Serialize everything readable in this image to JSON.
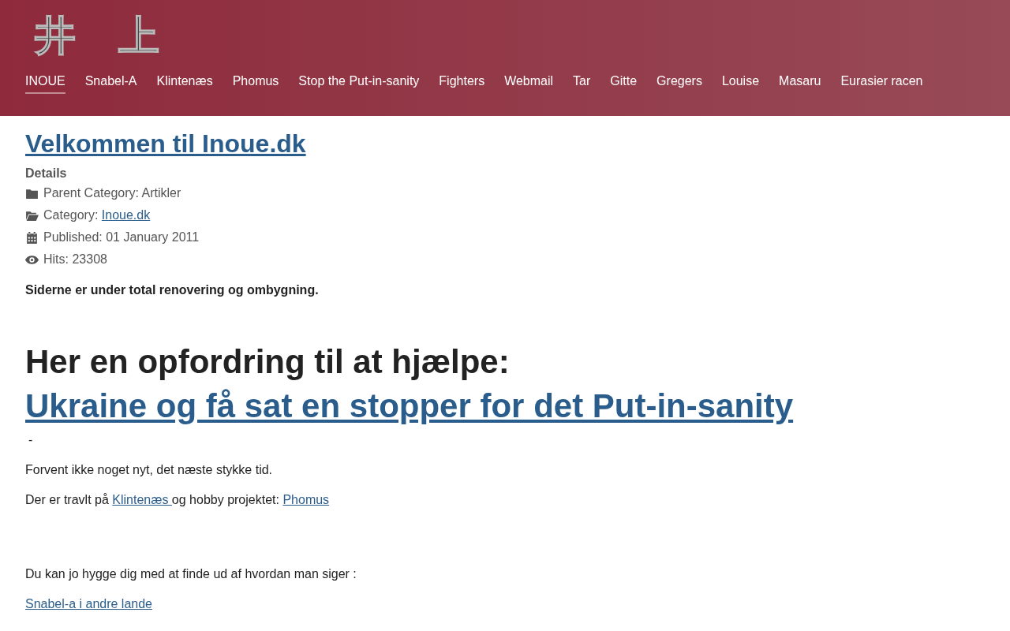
{
  "logo": {
    "text": "井 上"
  },
  "nav": [
    {
      "label": "INOUE",
      "selected": true
    },
    {
      "label": "Snabel-A",
      "selected": false
    },
    {
      "label": "Klintenæs",
      "selected": false
    },
    {
      "label": "Phomus",
      "selected": false
    },
    {
      "label": "Stop the Put-in-sanity",
      "selected": false
    },
    {
      "label": "Fighters",
      "selected": false
    },
    {
      "label": "Webmail",
      "selected": false
    },
    {
      "label": "Tar",
      "selected": false
    },
    {
      "label": "Gitte",
      "selected": false
    },
    {
      "label": "Gregers",
      "selected": false
    },
    {
      "label": "Louise",
      "selected": false
    },
    {
      "label": "Masaru",
      "selected": false
    },
    {
      "label": "Eurasier racen",
      "selected": false
    }
  ],
  "article": {
    "title": "Velkommen til Inoue.dk",
    "details_label": "Details",
    "meta": [
      {
        "kind": "folder",
        "label": "Parent Category: Artikler"
      },
      {
        "kind": "folder-open",
        "label": "Category: ",
        "link": "Inoue.dk"
      },
      {
        "kind": "calendar",
        "label": "Published: 01 January 2011"
      },
      {
        "kind": "eye",
        "label": "Hits: 23308"
      }
    ],
    "notice": "Siderne er under total renovering og ombygning.",
    "heading": "Her en opfordring til at hjælpe:",
    "heading_link": "Ukraine og få sat en stopper for det Put-in-sanity",
    "dash": "-",
    "paragraphs": [
      [
        {
          "text": "Forvent ikke noget nyt, det næste stykke tid."
        }
      ],
      [
        {
          "text": "Der er travlt på "
        },
        {
          "link": "Klintenæs "
        },
        {
          "text": "og hobby projektet: "
        },
        {
          "link": "Phomus"
        }
      ]
    ],
    "closing": "Du kan jo hygge dig med at finde ud af hvordan man siger :",
    "closing_link": "Snabel-a i andre lande"
  }
}
